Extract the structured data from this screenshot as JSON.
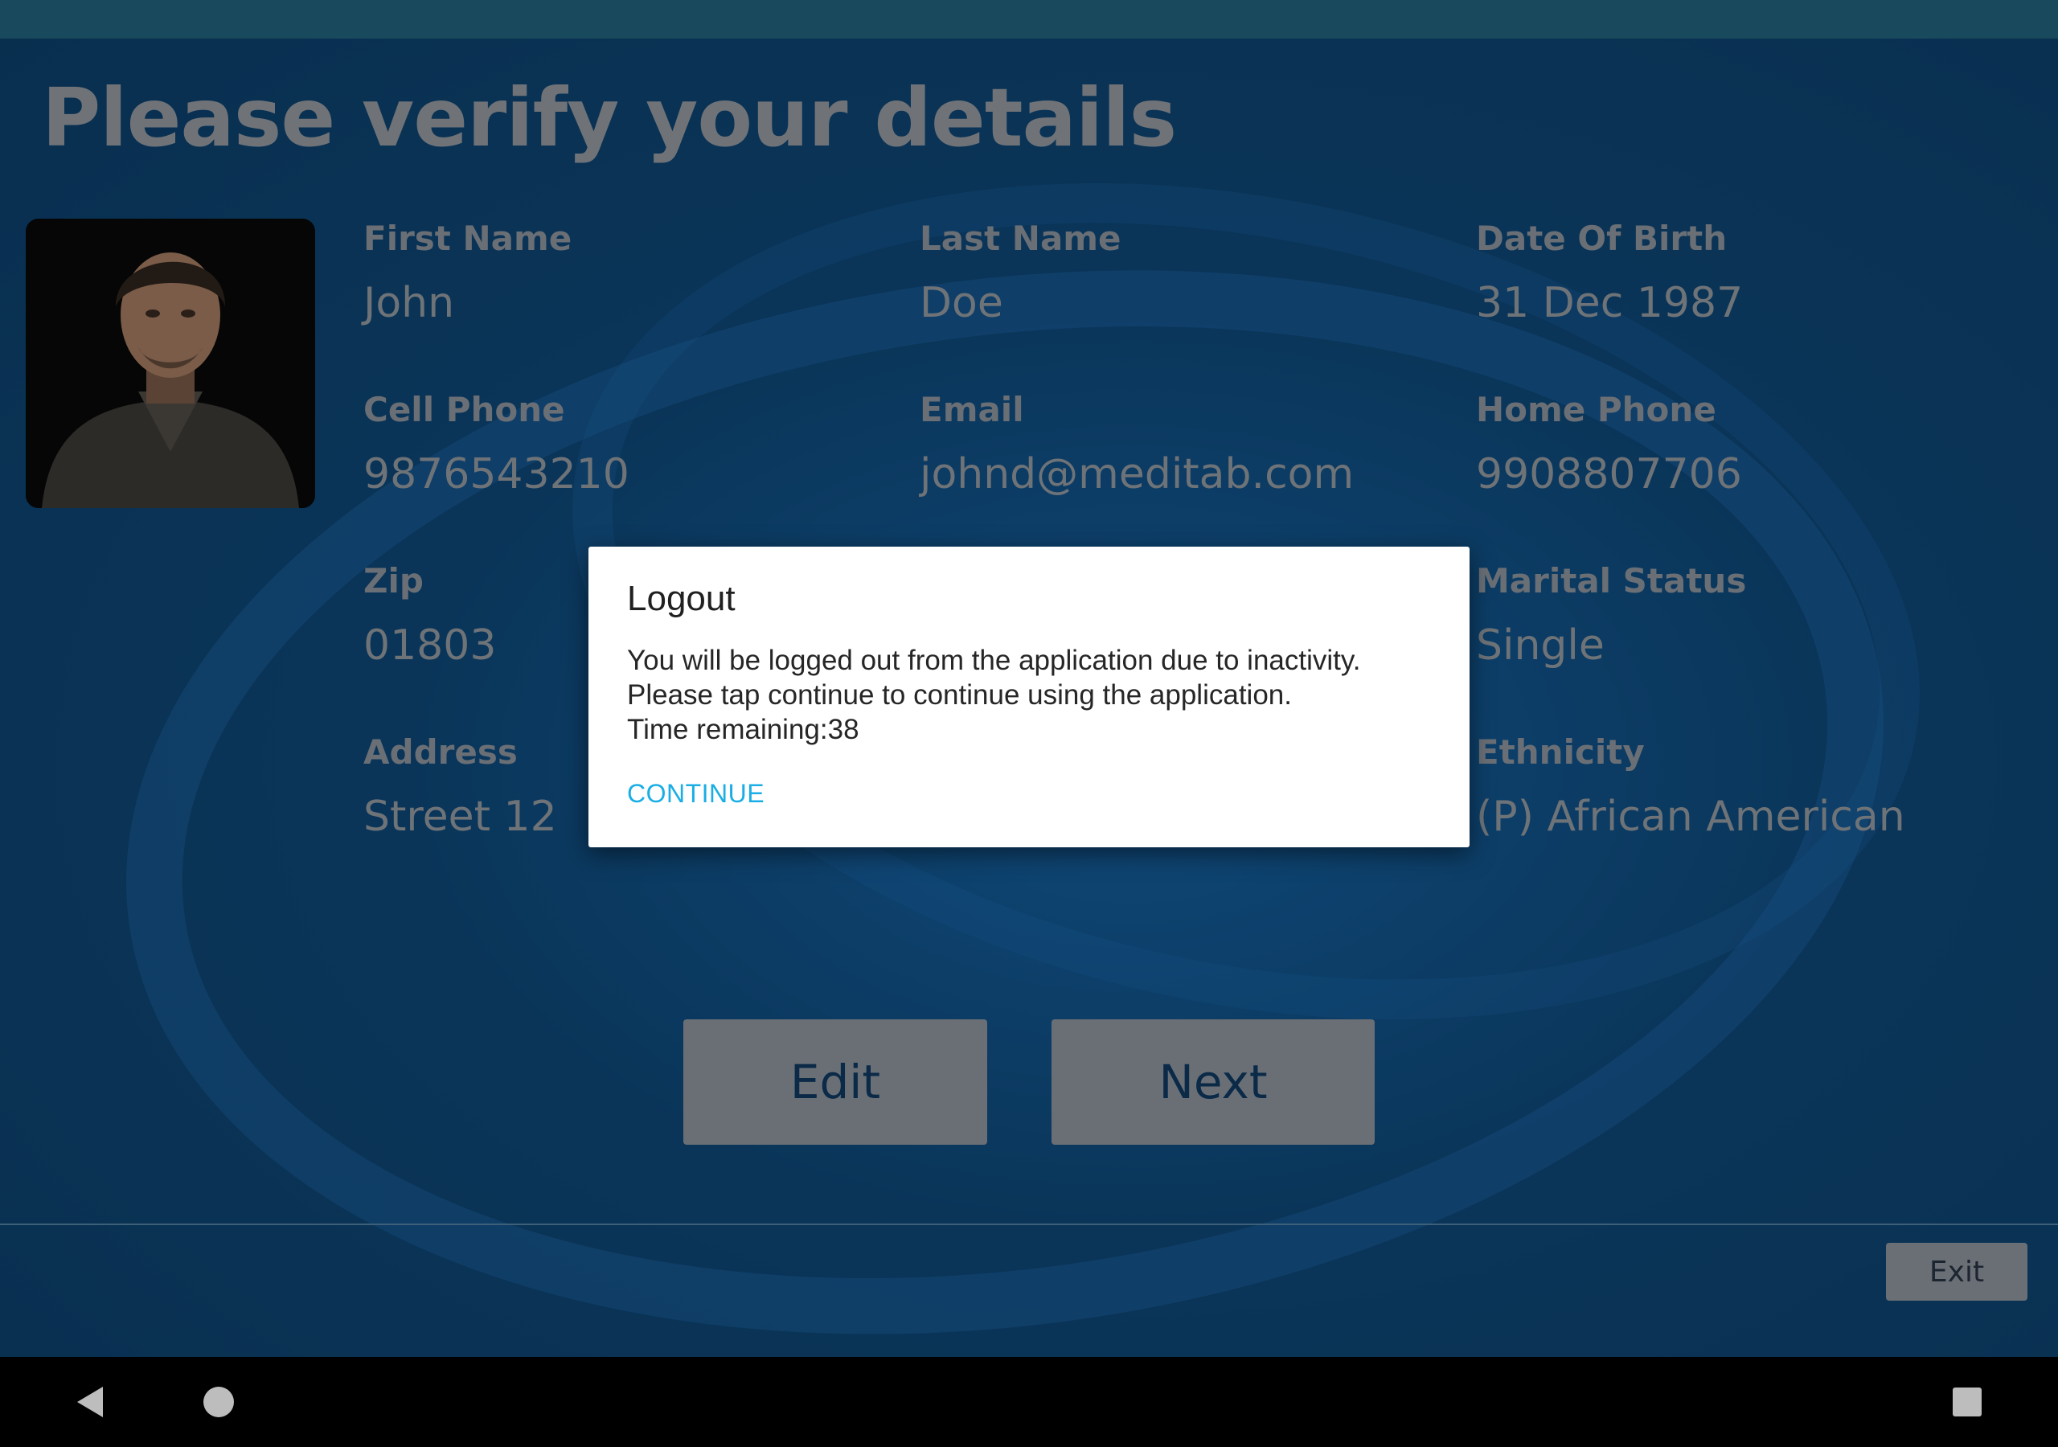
{
  "page": {
    "title": "Please verify your details"
  },
  "profile": {
    "avatar_alt": "User profile photo"
  },
  "fields": {
    "first_name": {
      "label": "First Name",
      "value": "John"
    },
    "last_name": {
      "label": "Last Name",
      "value": "Doe"
    },
    "dob": {
      "label": "Date Of Birth",
      "value": "31 Dec 1987"
    },
    "cell_phone": {
      "label": "Cell Phone",
      "value": "9876543210"
    },
    "email": {
      "label": "Email",
      "value": "johnd@meditab.com"
    },
    "home_phone": {
      "label": "Home Phone",
      "value": "9908807706"
    },
    "zip": {
      "label": "Zip",
      "value": "01803"
    },
    "marital_status": {
      "label": "Marital Status",
      "value": "Single"
    },
    "address": {
      "label": "Address",
      "value": "Street 12"
    },
    "ethnicity": {
      "label": "Ethnicity",
      "value": "(P) African American"
    }
  },
  "actions": {
    "edit_label": "Edit",
    "next_label": "Next",
    "exit_label": "Exit"
  },
  "dialog": {
    "title": "Logout",
    "line1": "You will be logged out from the application due to inactivity.",
    "line2": "Please tap continue to continue using the application.",
    "line3": "Time remaining:38",
    "continue_label": "CONTINUE"
  },
  "navbar": {
    "back_icon": "back-triangle-icon",
    "home_icon": "home-circle-icon",
    "recents_icon": "recents-square-icon"
  },
  "colors": {
    "background": "#0b2f4c",
    "dim_text": "#6e7378",
    "accent": "#1aaee4",
    "dialog_bg": "#ffffff"
  }
}
